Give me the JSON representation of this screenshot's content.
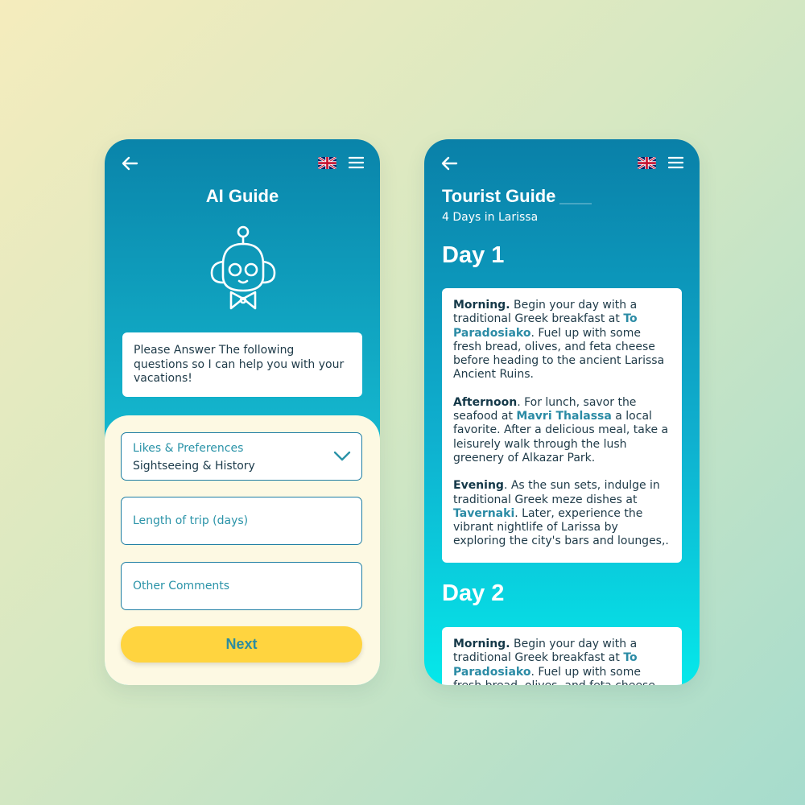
{
  "colors": {
    "primary": "#0a84aa",
    "accent_yellow": "#ffd43f",
    "link_teal": "#2b8ba5",
    "form_background": "#fdf9e3"
  },
  "icons": {
    "back": "arrow-left",
    "language": "uk-flag",
    "menu": "hamburger",
    "mascot": "robot",
    "dropdown": "chevron-down"
  },
  "ai_guide": {
    "title": "AI Guide",
    "intro": "Please Answer The following questions so I can help you with your vacations!",
    "form": {
      "likes": {
        "label": "Likes & Preferences",
        "value": "Sightseeing & History"
      },
      "length_placeholder": "Length of trip (days)",
      "comments_placeholder": "Other Comments",
      "next_label": "Next"
    }
  },
  "tourist_guide": {
    "title": "Tourist Guide",
    "subtitle": "4 Days in Larissa",
    "days": [
      {
        "heading": "Day 1",
        "morning": {
          "label": "Morning.",
          "text1": " Begin your day with a traditional Greek breakfast at ",
          "place": "To Paradosiako",
          "text2": ". Fuel up with some fresh bread, olives, and feta cheese before heading to the ancient Larissa Ancient Ruins."
        },
        "afternoon": {
          "label": "Afternoon",
          "text1": ". For lunch, savor the seafood at ",
          "place": "Mavri Thalassa",
          "text2": " a local favorite. After a delicious meal, take a leisurely walk through the lush greenery of Alkazar Park."
        },
        "evening": {
          "label": "Evening",
          "text1": ". As the sun sets, indulge in traditional Greek meze dishes at ",
          "place": "Tavernaki",
          "text2": ". Later, experience the vibrant nightlife of Larissa by exploring the city's bars and lounges,."
        }
      },
      {
        "heading": "Day 2",
        "morning": {
          "label": "Morning.",
          "text1": " Begin your day with a traditional Greek breakfast at ",
          "place": "To Paradosiako",
          "text2": ". Fuel up with some fresh bread, olives, and feta cheese before"
        }
      }
    ]
  }
}
